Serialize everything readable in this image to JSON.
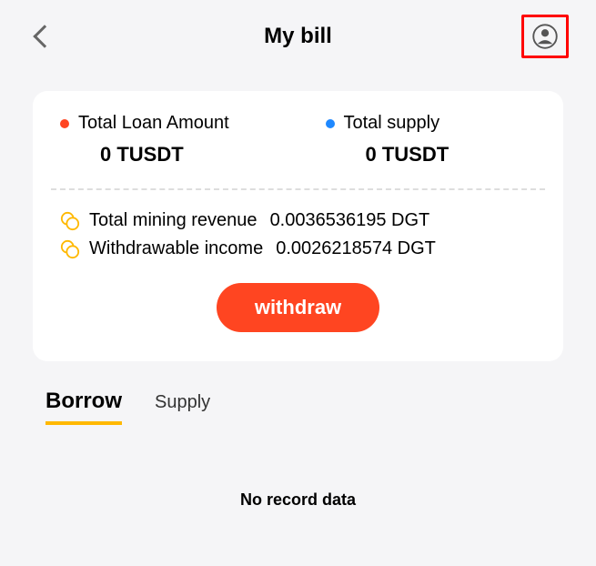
{
  "header": {
    "title": "My bill"
  },
  "colors": {
    "loan_dot": "#ff4521",
    "supply_dot": "#1e88ff",
    "accent": "#ff4521",
    "tab_underline": "#ffb800"
  },
  "totals": {
    "loan": {
      "label": "Total Loan Amount",
      "value": "0 TUSDT"
    },
    "supply": {
      "label": "Total supply",
      "value": "0 TUSDT"
    }
  },
  "revenue": {
    "mining": {
      "label": "Total mining revenue",
      "value": "0.0036536195 DGT"
    },
    "withdrawable": {
      "label": "Withdrawable income",
      "value": "0.0026218574 DGT"
    }
  },
  "buttons": {
    "withdraw": "withdraw"
  },
  "tabs": {
    "borrow": "Borrow",
    "supply": "Supply"
  },
  "empty": {
    "message": "No record data"
  }
}
